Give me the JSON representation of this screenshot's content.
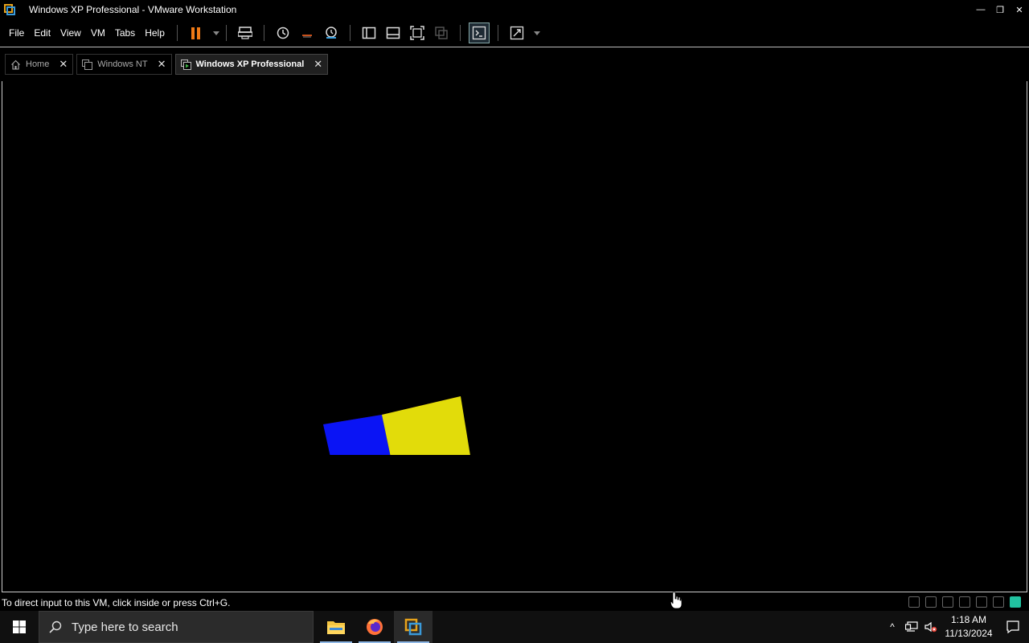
{
  "window": {
    "title": "Windows XP Professional - VMware Workstation",
    "controls": {
      "minimize": "—",
      "restore": "❐",
      "close": "✕"
    }
  },
  "menu": {
    "items": [
      {
        "label": "File"
      },
      {
        "label": "Edit"
      },
      {
        "label": "View"
      },
      {
        "label": "VM"
      },
      {
        "label": "Tabs"
      },
      {
        "label": "Help"
      }
    ]
  },
  "toolbar": {
    "icons": [
      "pause-icon",
      "send-keys-icon",
      "snapshot-icon",
      "revert-snapshot-icon",
      "snapshot-manager-icon",
      "library-icon",
      "thumbnail-bar-icon",
      "full-screen-icon",
      "unity-icon",
      "console-view-icon",
      "stretch-guest-icon"
    ]
  },
  "tabs": [
    {
      "label": "Home",
      "close": "✕",
      "active": false
    },
    {
      "label": "Windows NT",
      "close": "✕",
      "active": false
    },
    {
      "label": "Windows XP Professional",
      "close": "✕",
      "active": true
    }
  ],
  "viewport": {
    "cube_colors": {
      "left_face": "#0a14f5",
      "right_face": "#e2dc0a",
      "top_edge": "#6a0c0c"
    }
  },
  "status": {
    "message": "To direct input to this VM, click inside or press Ctrl+G."
  },
  "taskbar": {
    "search_placeholder": "Type here to search",
    "apps": [
      "file-explorer-icon",
      "firefox-icon",
      "vmware-workstation-icon"
    ],
    "clock": {
      "time": "1:18 AM",
      "date": "11/13/2024"
    },
    "tray_overflow": "^"
  },
  "colors": {
    "accent_orange": "#f07a16",
    "taskbar_bg": "#101010",
    "tray_status_green": "#21c2a0"
  }
}
